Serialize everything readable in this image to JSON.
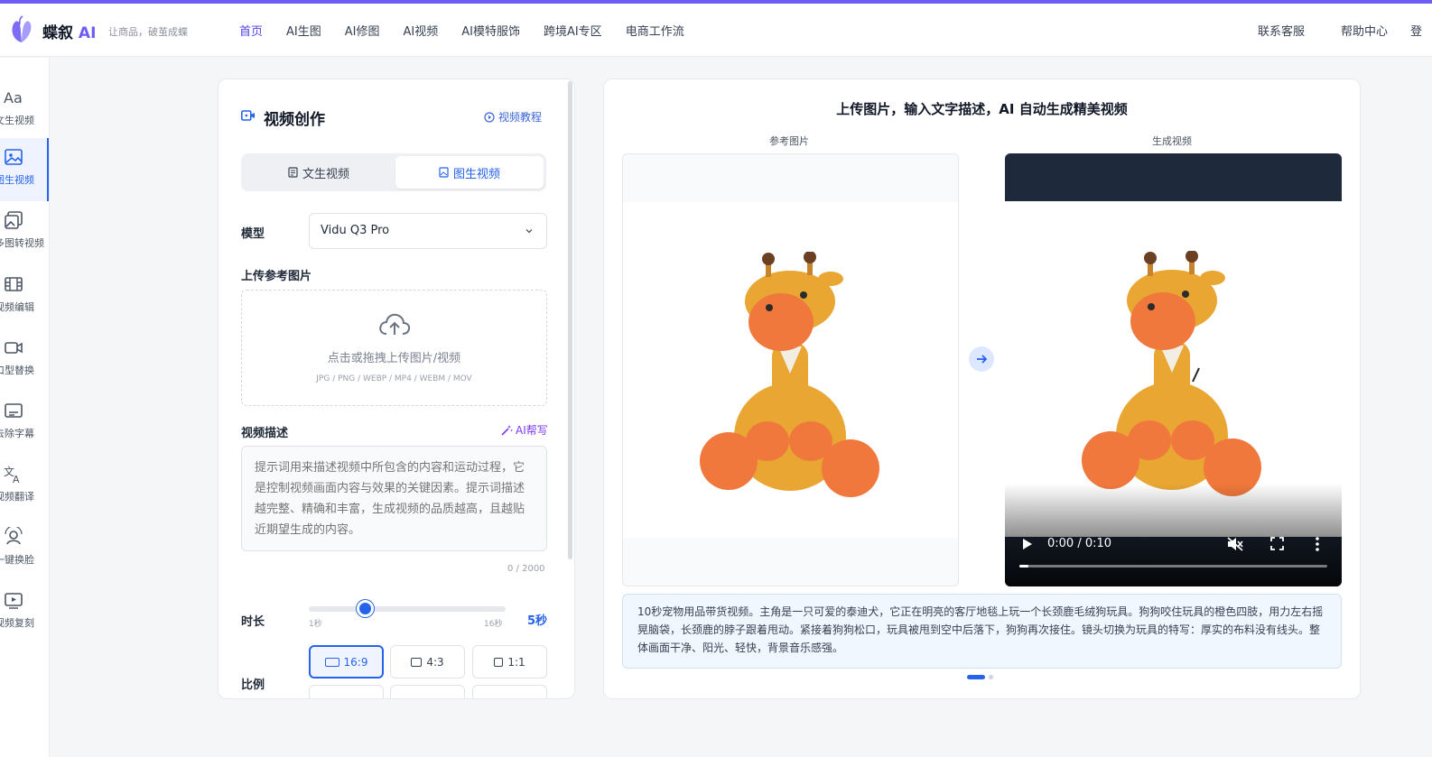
{
  "brand": {
    "name": "蝶叙",
    "ai": "AI",
    "slogan": "让商品，破茧成蝶",
    "accent_color": "#6d5cf6"
  },
  "nav": {
    "items": [
      "首页",
      "AI生图",
      "AI修图",
      "AI视频",
      "AI模特服饰",
      "跨境AI专区",
      "电商工作流"
    ],
    "active_index": 0,
    "right": [
      "联系客服",
      "帮助中心"
    ],
    "right_cut": "登"
  },
  "sidebar": {
    "items": [
      {
        "label": "文生视频",
        "icon": "text-aa-icon"
      },
      {
        "label": "图生视频",
        "icon": "image-icon"
      },
      {
        "label": "多图转视频",
        "icon": "images-icon"
      },
      {
        "label": "视频编辑",
        "icon": "film-icon"
      },
      {
        "label": "口型替换",
        "icon": "camera-icon"
      },
      {
        "label": "去除字幕",
        "icon": "subtitle-icon"
      },
      {
        "label": "视频翻译",
        "icon": "translate-icon"
      },
      {
        "label": "一键换脸",
        "icon": "face-swap-icon"
      },
      {
        "label": "视频复刻",
        "icon": "video-replay-icon"
      }
    ],
    "active_index": 1
  },
  "panel": {
    "title": "视频创作",
    "tutorial": "视频教程",
    "tabs": [
      "文生视频",
      "图生视频"
    ],
    "active_tab": 1,
    "model_label": "模型",
    "model_value": "Vidu Q3 Pro",
    "upload_label": "上传参考图片",
    "upload_text": "点击或拖拽上传图片/视频",
    "upload_formats": "JPG / PNG / WEBP / MP4 / WEBM / MOV",
    "desc_label": "视频描述",
    "ai_help": "AI帮写",
    "desc_placeholder": "提示词用来描述视频中所包含的内容和运动过程，它是控制视频画面内容与效果的关键因素。提示词描述越完整、精确和丰富，生成视频的品质越高，且越贴近期望生成的内容。",
    "counter": "0 / 2000",
    "duration_label": "时长",
    "duration_min": "1秒",
    "duration_max": "16秒",
    "duration_value": "5秒",
    "duration_seconds": 5,
    "ratio_label": "比例",
    "ratios": [
      "16:9",
      "4:3",
      "1:1"
    ],
    "active_ratio": 0
  },
  "main": {
    "title": "上传图片，输入文字描述，AI 自动生成精美视频",
    "ref_caption": "参考图片",
    "gen_caption": "生成视频",
    "video_time": "0:00 / 0:10",
    "video_progress_percent": 3,
    "description": "10秒宠物用品带货视频。主角是一只可爱的泰迪犬，它正在明亮的客厅地毯上玩一个长颈鹿毛绒狗玩具。狗狗咬住玩具的橙色四肢，用力左右摇晃脑袋，长颈鹿的脖子跟着甩动。紧接着狗狗松口，玩具被甩到空中后落下，狗狗再次接住。镜头切换为玩具的特写：厚实的布料没有线头。整体画面干净、阳光、轻快，背景音乐感强。",
    "carousel_count": 2,
    "carousel_active": 0
  }
}
